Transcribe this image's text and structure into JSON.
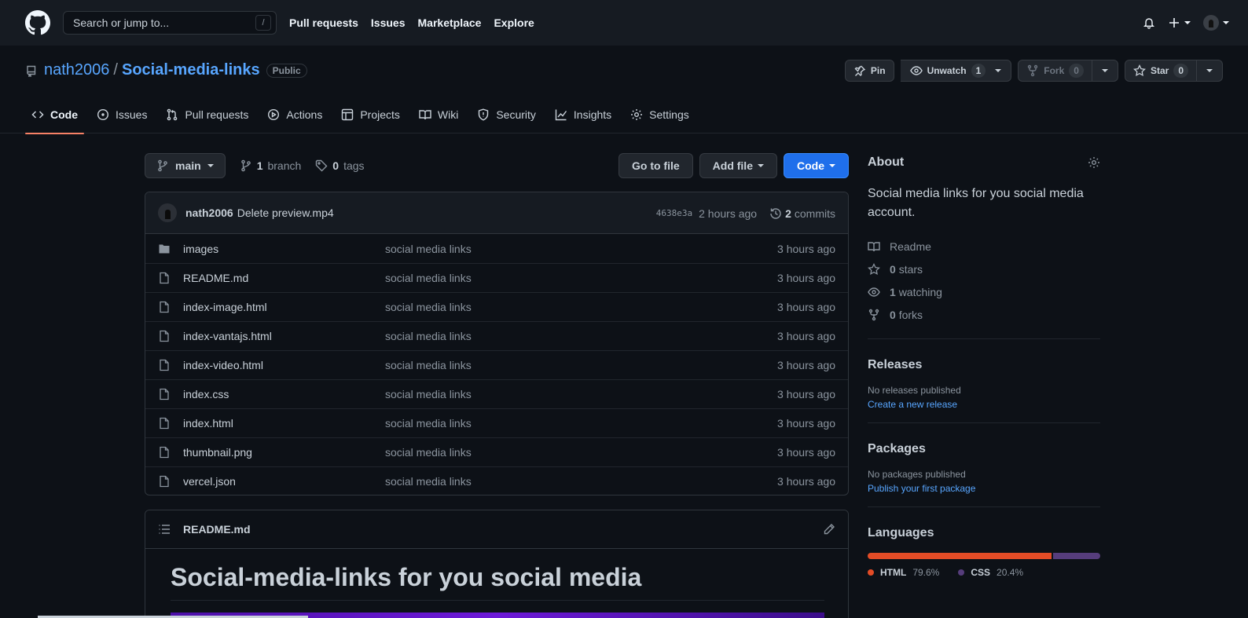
{
  "header": {
    "search_placeholder": "Search or jump to...",
    "search_shortcut": "/",
    "nav": [
      "Pull requests",
      "Issues",
      "Marketplace",
      "Explore"
    ]
  },
  "repo": {
    "owner": "nath2006",
    "separator": "/",
    "name": "Social-media-links",
    "visibility": "Public",
    "actions": {
      "pin": "Pin",
      "unwatch": "Unwatch",
      "unwatch_count": "1",
      "fork": "Fork",
      "fork_count": "0",
      "star": "Star",
      "star_count": "0"
    },
    "tabs": [
      "Code",
      "Issues",
      "Pull requests",
      "Actions",
      "Projects",
      "Wiki",
      "Security",
      "Insights",
      "Settings"
    ]
  },
  "toolbar": {
    "branch": "main",
    "branch_count": "1",
    "branch_label": "branch",
    "tag_count": "0",
    "tag_label": "tags",
    "go_to_file": "Go to file",
    "add_file": "Add file",
    "code": "Code"
  },
  "commit": {
    "author": "nath2006",
    "message": "Delete preview.mp4",
    "sha": "4638e3a",
    "time": "2 hours ago",
    "commit_count": "2",
    "commit_label": "commits"
  },
  "files": [
    {
      "name": "images",
      "type": "dir",
      "message": "social media links",
      "age": "3 hours ago"
    },
    {
      "name": "README.md",
      "type": "file",
      "message": "social media links",
      "age": "3 hours ago"
    },
    {
      "name": "index-image.html",
      "type": "file",
      "message": "social media links",
      "age": "3 hours ago"
    },
    {
      "name": "index-vantajs.html",
      "type": "file",
      "message": "social media links",
      "age": "3 hours ago"
    },
    {
      "name": "index-video.html",
      "type": "file",
      "message": "social media links",
      "age": "3 hours ago"
    },
    {
      "name": "index.css",
      "type": "file",
      "message": "social media links",
      "age": "3 hours ago"
    },
    {
      "name": "index.html",
      "type": "file",
      "message": "social media links",
      "age": "3 hours ago"
    },
    {
      "name": "thumbnail.png",
      "type": "file",
      "message": "social media links",
      "age": "3 hours ago"
    },
    {
      "name": "vercel.json",
      "type": "file",
      "message": "social media links",
      "age": "3 hours ago"
    }
  ],
  "readme": {
    "file": "README.md",
    "heading": "Social-media-links for you social media"
  },
  "about": {
    "title": "About",
    "description": "Social media links for you social media account.",
    "readme": "Readme",
    "stars_count": "0",
    "stars_label": "stars",
    "watching_count": "1",
    "watching_label": "watching",
    "forks_count": "0",
    "forks_label": "forks"
  },
  "releases": {
    "title": "Releases",
    "empty": "No releases published",
    "link": "Create a new release"
  },
  "packages": {
    "title": "Packages",
    "empty": "No packages published",
    "link": "Publish your first package"
  },
  "languages": {
    "title": "Languages",
    "items": [
      {
        "name": "HTML",
        "percent": "79.6%",
        "value": 79.6,
        "color": "#e34c26"
      },
      {
        "name": "CSS",
        "percent": "20.4%",
        "value": 20.4,
        "color": "#563d7c"
      }
    ]
  }
}
